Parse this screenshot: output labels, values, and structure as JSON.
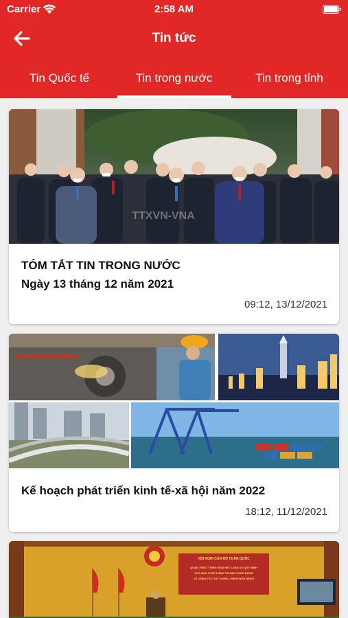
{
  "status_bar": {
    "carrier": "Carrier",
    "time": "2:58 AM",
    "icons": [
      "wifi-icon",
      "battery-icon"
    ]
  },
  "nav": {
    "title": "Tin tức",
    "back_icon": "arrow-left-icon"
  },
  "tabs": [
    {
      "label": "Tin Quốc tế",
      "selected": false
    },
    {
      "label": "Tin trong nước",
      "selected": true
    },
    {
      "label": "Tin trong tỉnh",
      "selected": false
    }
  ],
  "articles": [
    {
      "title_line1": "TÓM TẮT TIN TRONG NƯỚC",
      "title_line2": "Ngày 13 tháng 12 năm 2021",
      "time": "09:12, 13/12/2021",
      "image_watermark": "TTXVN-VNA"
    },
    {
      "title": "Kế hoạch phát triển kinh tế-xã hội năm 2022",
      "time": "18:12, 11/12/2021"
    },
    {
      "banner_line1": "HỘI NGHỊ CÁN BỘ TOÀN QUỐC",
      "banner_line2": "QUÁN TRIỆT, TRIỂN KHAI KẾT LUẬN VÀ QUY ĐỊNH",
      "banner_line3": "CỦA BAN CHẤP HÀNH TRUNG ƯƠNG ĐẢNG",
      "banner_line4": "VỀ CÔNG TÁC XÂY DỰNG, CHỈNH ĐỐN ĐẢNG"
    }
  ],
  "colors": {
    "header": "#e02826",
    "background": "#efefef",
    "card": "#ffffff"
  }
}
